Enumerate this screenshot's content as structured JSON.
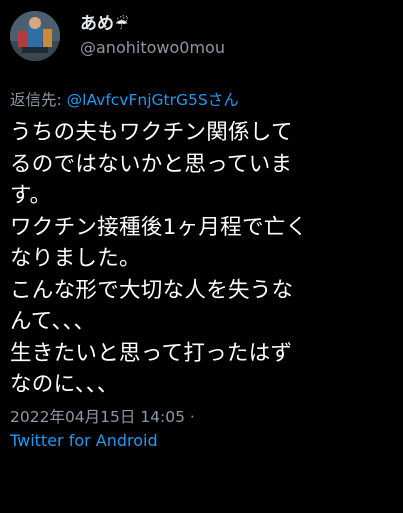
{
  "user": {
    "display_name": "あめ",
    "name_emoji": "☔",
    "handle": "@anohitowo0mou"
  },
  "reply": {
    "prefix": "返信先: ",
    "mention": "@lAvfcvFnjGtrG5Sさん"
  },
  "tweet": {
    "lines": [
      "うちの夫もワクチン関係して",
      "るのではないかと思っていま",
      "す。",
      "ワクチン接種後1ヶ月程で亡く",
      "なりました。",
      "こんな形で大切な人を失うな",
      "んて、、、",
      "生きたいと思って打ったはず",
      "なのに、、、"
    ]
  },
  "meta": {
    "timestamp": "2022年04月15日 14:05 ·",
    "source": "Twitter for Android"
  },
  "colors": {
    "background": "#000000",
    "text": "#ffffff",
    "secondary_text": "#8b98a5",
    "accent": "#1d9bf0"
  },
  "icons": {
    "avatar": "profile-avatar-image",
    "name_badge": "umbrella-icon"
  }
}
